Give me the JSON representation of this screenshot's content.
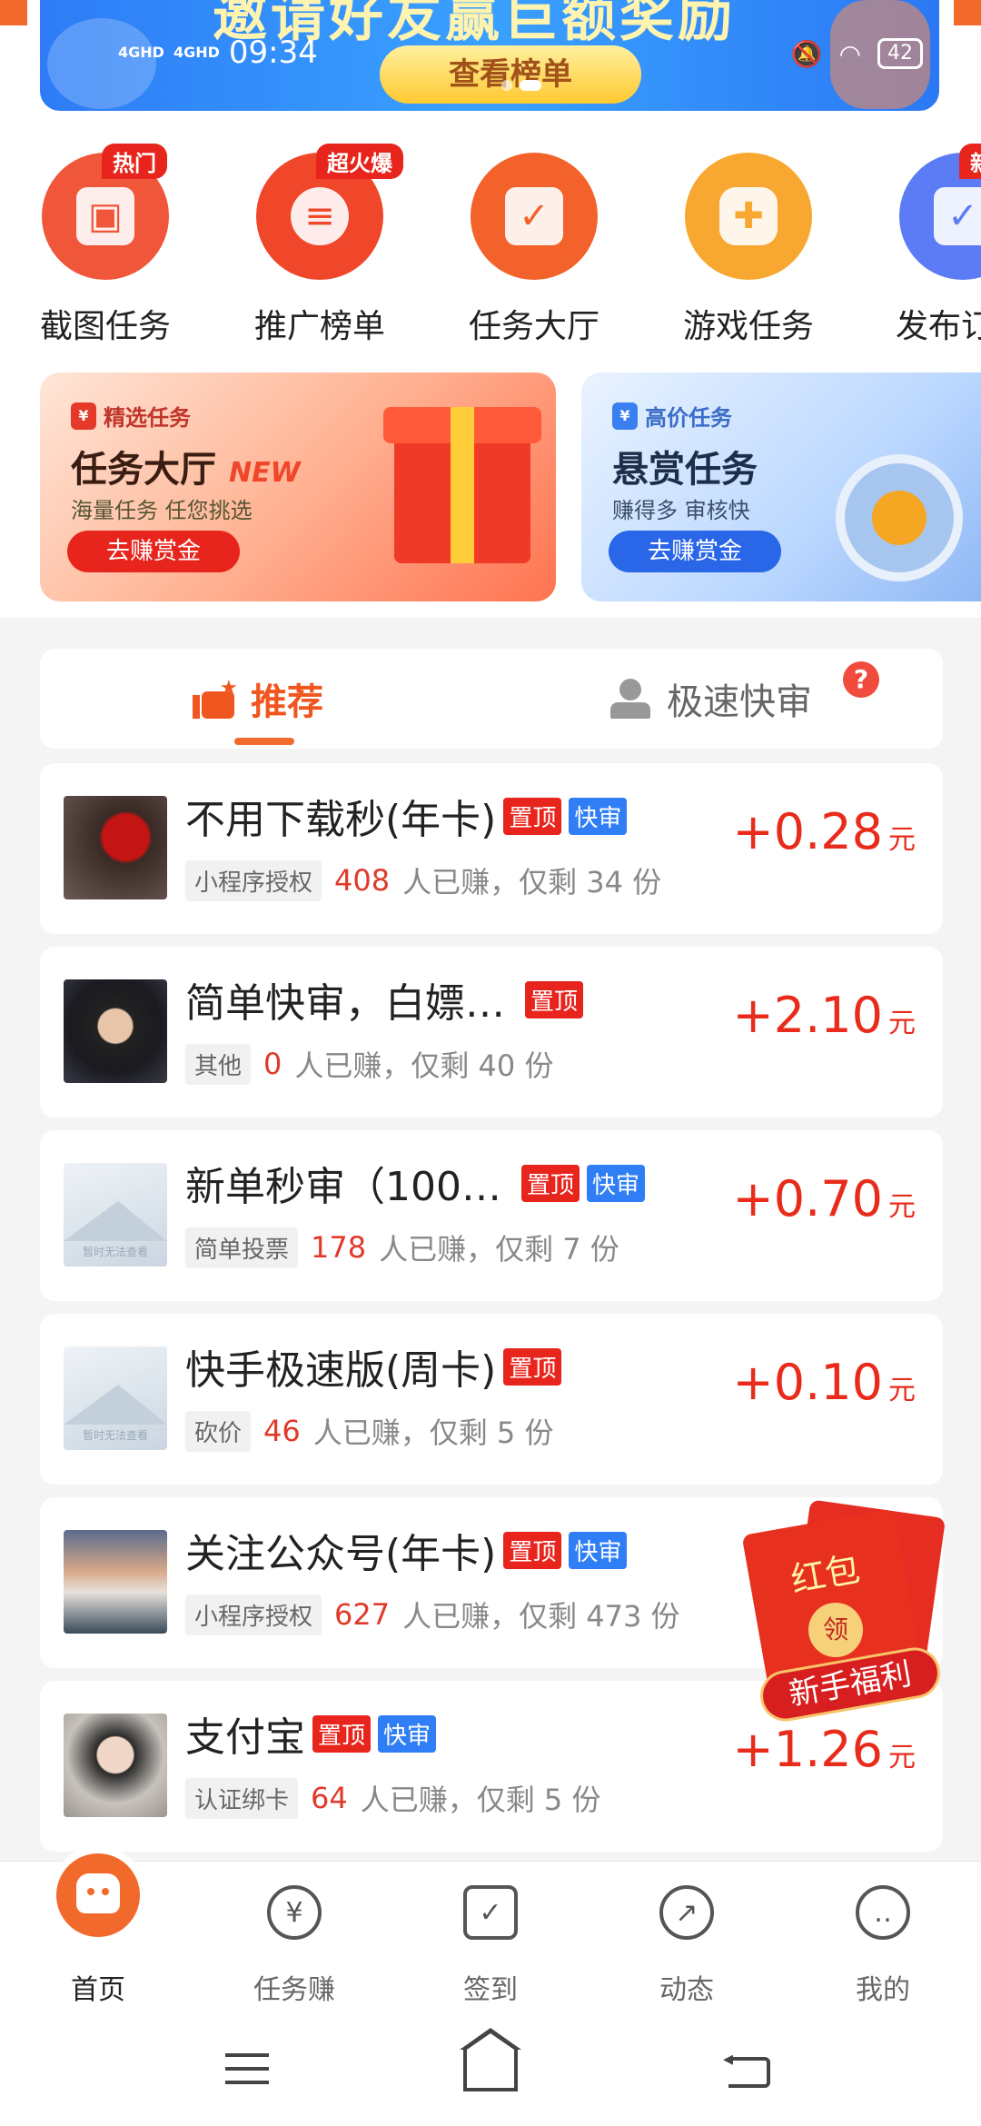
{
  "status_bar": {
    "signal1": "4GHD",
    "signal2": "4GHD",
    "time": "09:34",
    "battery": "42"
  },
  "banner": {
    "title": "邀请好友赢巨额奖励",
    "button": "查看榜单"
  },
  "icon_row": [
    {
      "label": "截图任务",
      "badge": "热门",
      "color": "#f0563a",
      "icon": "image-icon"
    },
    {
      "label": "推广榜单",
      "badge": "超火爆",
      "color": "#f0462a",
      "icon": "coins-icon"
    },
    {
      "label": "任务大厅",
      "badge": "",
      "color": "#f2622a",
      "icon": "clipboard-check-icon"
    },
    {
      "label": "游戏任务",
      "badge": "",
      "color": "#f8a830",
      "icon": "gamepad-icon"
    },
    {
      "label": "发布订",
      "badge": "新进",
      "color": "#5b7cf5",
      "icon": "publish-icon"
    }
  ],
  "promo_cards": {
    "left": {
      "tag": "精选任务",
      "title": "任务大厅",
      "new": "NEW",
      "subtitle": "海量任务 任您挑选",
      "button": "去赚赏金"
    },
    "right": {
      "tag": "高价任务",
      "title": "悬赏任务",
      "subtitle": "赚得多 审核快",
      "button": "去赚赏金"
    }
  },
  "tabs": {
    "active": "推荐",
    "inactive": "极速快审",
    "help": "?"
  },
  "tasks": [
    {
      "title": "不用下载秒(年卡)",
      "top": "置顶",
      "fast": "快审",
      "category": "小程序授权",
      "earned": "408",
      "earned_text": "人已赚，仅剩 34 份",
      "reward": "+0.28",
      "unit": "元"
    },
    {
      "title": "简单快审，白嫖…",
      "top": "置顶",
      "fast": "",
      "category": "其他",
      "earned": "0",
      "earned_text": "人已赚，仅剩 40 份",
      "reward": "+2.10",
      "unit": "元"
    },
    {
      "title": "新单秒审（100…",
      "top": "置顶",
      "fast": "快审",
      "category": "简单投票",
      "earned": "178",
      "earned_text": "人已赚，仅剩 7 份",
      "reward": "+0.70",
      "unit": "元"
    },
    {
      "title": "快手极速版(周卡)",
      "top": "置顶",
      "fast": "",
      "category": "砍价",
      "earned": "46",
      "earned_text": "人已赚，仅剩 5 份",
      "reward": "+0.10",
      "unit": "元"
    },
    {
      "title": "关注公众号(年卡)",
      "top": "置顶",
      "fast": "快审",
      "category": "小程序授权",
      "earned": "627",
      "earned_text": "人已赚，仅剩 473 份",
      "reward": "",
      "unit": ""
    },
    {
      "title": "支付宝",
      "top": "置顶",
      "fast": "快审",
      "category": "认证绑卡",
      "earned": "64",
      "earned_text": "人已赚，仅剩 5 份",
      "reward": "+1.26",
      "unit": "元"
    }
  ],
  "thumb_placeholder_text": "暂时无法查看",
  "red_envelope": {
    "title": "红包",
    "coin": "领",
    "ribbon": "新手福利"
  },
  "bottom_nav": [
    {
      "label": "首页",
      "icon": "home-face-icon"
    },
    {
      "label": "任务赚",
      "icon": "yuan-coin-icon"
    },
    {
      "label": "签到",
      "icon": "calendar-check-icon"
    },
    {
      "label": "动态",
      "icon": "compass-icon"
    },
    {
      "label": "我的",
      "icon": "smiley-icon"
    }
  ],
  "colors": {
    "brand_orange": "#f26a2b",
    "reward_red": "#e82b1b",
    "badge_blue": "#2f7ef5",
    "badge_red": "#e8251d"
  }
}
